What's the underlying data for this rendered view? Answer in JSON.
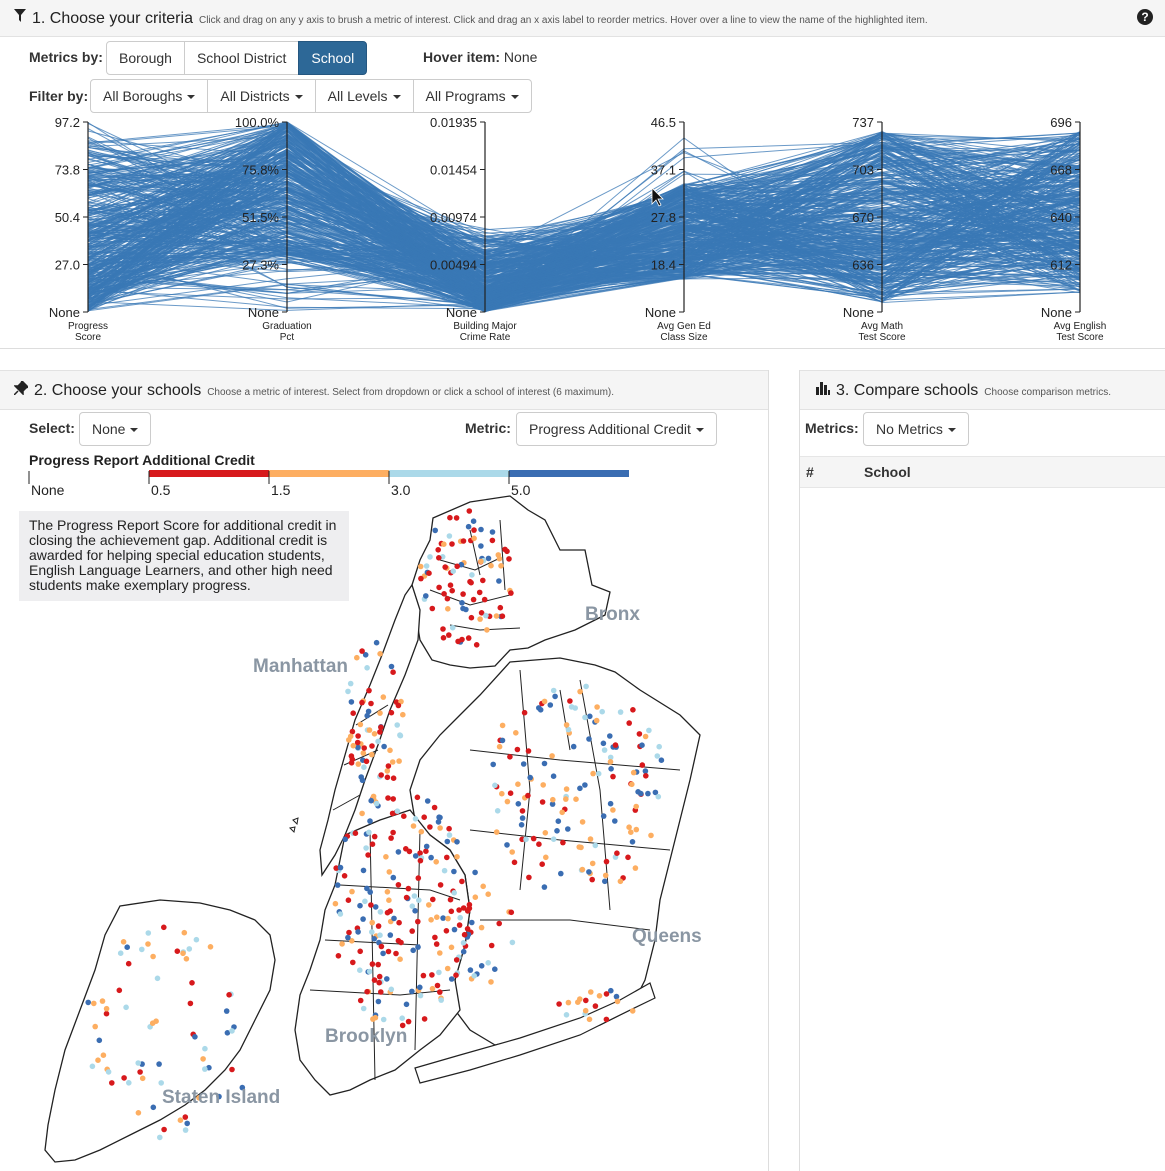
{
  "criteria": {
    "title": "1. Choose your criteria",
    "subtitle": "Click and drag on any y axis to brush a metric of interest. Click and drag an x axis label to reorder metrics. Hover over a line to view the name of the highlighted item.",
    "help_icon": "question-circle-icon",
    "metrics_by_label": "Metrics by:",
    "metrics_by_options": [
      "Borough",
      "School District",
      "School"
    ],
    "metrics_by_selected": "School",
    "hover_label": "Hover item:",
    "hover_value": "None",
    "filter_by_label": "Filter by:",
    "filters": [
      "All Boroughs",
      "All Districts",
      "All Levels",
      "All Programs"
    ]
  },
  "chart_data": {
    "type": "parallel-coordinates",
    "line_color": "#3a78b5",
    "axes": [
      {
        "name": "Progress Score",
        "label_lines": [
          "Progress",
          "Score"
        ],
        "ticks": [
          "97.2",
          "73.8",
          "50.4",
          "27.0",
          "None"
        ]
      },
      {
        "name": "Graduation Pct",
        "label_lines": [
          "Graduation",
          "Pct"
        ],
        "ticks": [
          "100.0%",
          "75.8%",
          "51.5%",
          "27.3%",
          "None"
        ]
      },
      {
        "name": "Building Major Crime Rate",
        "label_lines": [
          "Building Major",
          "Crime Rate"
        ],
        "ticks": [
          "0.01935",
          "0.01454",
          "0.00974",
          "0.00494",
          "None"
        ]
      },
      {
        "name": "Avg Gen Ed Class Size",
        "label_lines": [
          "Avg Gen Ed",
          "Class Size"
        ],
        "ticks": [
          "46.5",
          "37.1",
          "27.8",
          "18.4",
          "None"
        ]
      },
      {
        "name": "Avg Math Test Score",
        "label_lines": [
          "Avg Math",
          "Test Score"
        ],
        "ticks": [
          "737",
          "703",
          "670",
          "636",
          "None"
        ]
      },
      {
        "name": "Avg English Test Score",
        "label_lines": [
          "Avg English",
          "Test Score"
        ],
        "ticks": [
          "696",
          "668",
          "640",
          "612",
          "None"
        ]
      }
    ]
  },
  "schools": {
    "title": "2. Choose your schools",
    "subtitle": "Choose a metric of interest. Select from dropdown or click a school of interest (6 maximum).",
    "pin_icon": "pushpin-icon",
    "select_label": "Select:",
    "select_value": "None",
    "metric_label": "Metric:",
    "metric_value": "Progress Additional Credit",
    "legend": {
      "title": "Progress Report Additional Credit",
      "none_label": "None",
      "stops": [
        "0.5",
        "1.5",
        "3.0",
        "5.0"
      ],
      "colors": [
        "#d7191c",
        "#fdae61",
        "#abd9e9",
        "#3a6db2"
      ]
    },
    "description": "The Progress Report Score for additional credit in closing the achievement gap. Additional credit is awarded for helping special education students, English Language Learners, and other high need students make exemplary progress.",
    "boroughs": [
      "Bronx",
      "Manhattan",
      "Queens",
      "Brooklyn",
      "Staten Island"
    ]
  },
  "compare": {
    "title": "3. Compare schools",
    "subtitle": "Choose comparison metrics.",
    "chart_icon": "bar-chart-icon",
    "metrics_label": "Metrics:",
    "metrics_value": "No Metrics",
    "columns": [
      "#",
      "School"
    ]
  }
}
